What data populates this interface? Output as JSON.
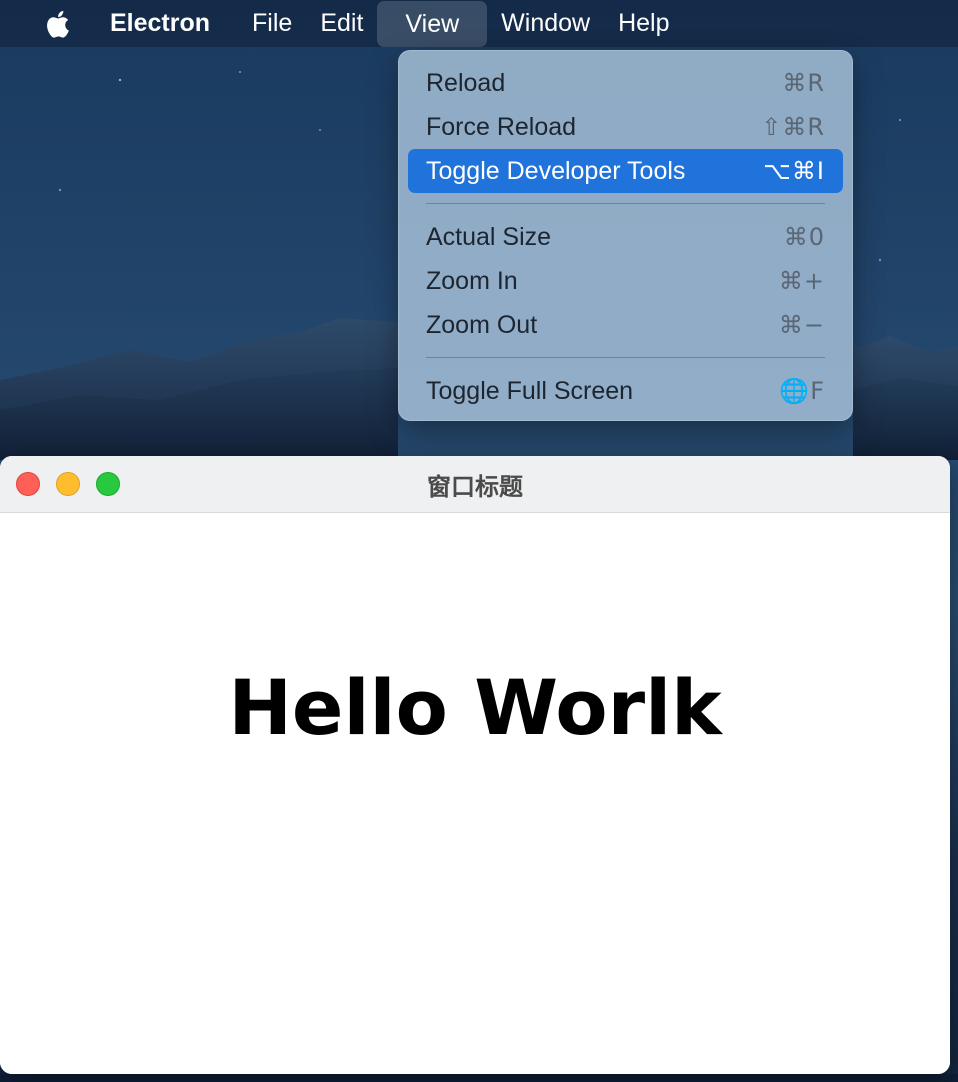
{
  "menubar": {
    "apple_icon": "apple-logo-icon",
    "app_name": "Electron",
    "items": [
      {
        "label": "File"
      },
      {
        "label": "Edit"
      },
      {
        "label": "View"
      },
      {
        "label": "Window"
      },
      {
        "label": "Help"
      }
    ],
    "active_item": "View"
  },
  "view_menu": {
    "groups": [
      [
        {
          "label": "Reload",
          "shortcut": "⌘R"
        },
        {
          "label": "Force Reload",
          "shortcut": "⇧⌘R"
        },
        {
          "label": "Toggle Developer Tools",
          "shortcut": "⌥⌘I",
          "highlighted": true
        }
      ],
      [
        {
          "label": "Actual Size",
          "shortcut": "⌘0"
        },
        {
          "label": "Zoom In",
          "shortcut": "⌘+"
        },
        {
          "label": "Zoom Out",
          "shortcut": "⌘−"
        }
      ],
      [
        {
          "label": "Toggle Full Screen",
          "shortcut": "🌐F"
        }
      ]
    ]
  },
  "window": {
    "title": "窗口标题",
    "content_heading": "Hello Worlk"
  },
  "colors": {
    "highlight": "#1f73db",
    "close": "#fe5f57",
    "minimize": "#febc2e",
    "maximize": "#28c840"
  }
}
